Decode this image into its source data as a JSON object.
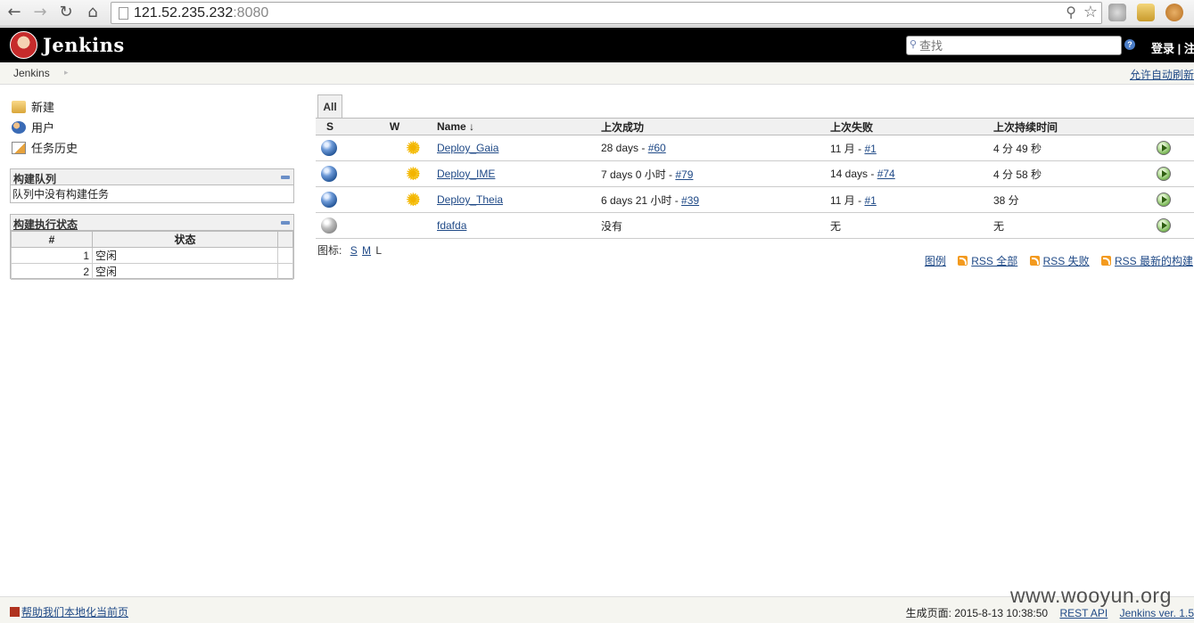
{
  "browser": {
    "url_host": "121.52.235.232",
    "url_port": ":8080"
  },
  "header": {
    "app_name": "Jenkins",
    "search_placeholder": "查找",
    "help_glyph": "?",
    "login_text": "登录 | 注"
  },
  "breadcrumb": {
    "root": "Jenkins",
    "auto_refresh": "允许自动刷新"
  },
  "sidebar": {
    "tasks": [
      {
        "label": "新建",
        "icon": "new-job-icon"
      },
      {
        "label": "用户",
        "icon": "users-icon"
      },
      {
        "label": "任务历史",
        "icon": "build-history-icon"
      }
    ],
    "queue": {
      "title": "构建队列",
      "empty_text": "队列中没有构建任务"
    },
    "executors": {
      "title": "构建执行状态",
      "col_number": "#",
      "col_status": "状态",
      "rows": [
        {
          "number": "1",
          "status": "空闲"
        },
        {
          "number": "2",
          "status": "空闲"
        }
      ]
    }
  },
  "main": {
    "tab_all": "All",
    "columns": {
      "s": "S",
      "w": "W",
      "name": "Name ↓",
      "last_success": "上次成功",
      "last_failure": "上次失败",
      "last_duration": "上次持续时间"
    },
    "jobs": [
      {
        "status": "blue",
        "weather": "sunny",
        "name": "Deploy_Gaia",
        "last_success_text": "28 days - ",
        "last_success_link": "#60",
        "last_failure_text": "11 月 - ",
        "last_failure_link": "#1",
        "duration": "4 分 49 秒"
      },
      {
        "status": "blue",
        "weather": "sunny",
        "name": "Deploy_IME",
        "last_success_text": "7 days 0 小时 - ",
        "last_success_link": "#79",
        "last_failure_text": "14 days - ",
        "last_failure_link": "#74",
        "duration": "4 分 58 秒"
      },
      {
        "status": "blue",
        "weather": "sunny",
        "name": "Deploy_Theia",
        "last_success_text": "6 days 21 小时 - ",
        "last_success_link": "#39",
        "last_failure_text": "11 月 - ",
        "last_failure_link": "#1",
        "duration": "38 分"
      },
      {
        "status": "grey",
        "weather": "",
        "name": "fdafda",
        "last_success_text": "没有",
        "last_success_link": "",
        "last_failure_text": "无",
        "last_failure_link": "",
        "duration": "无"
      }
    ],
    "icon_size": {
      "label": "图标:",
      "small": "S",
      "medium": "M",
      "large": "L"
    },
    "legend": "图例",
    "rss_all": "RSS 全部",
    "rss_failed": "RSS 失败",
    "rss_latest": "RSS 最新的构建"
  },
  "footer": {
    "localize": "帮助我们本地化当前页",
    "generated": "生成页面: 2015-8-13 10:38:50",
    "rest_api": "REST API",
    "version": "Jenkins ver. 1.5"
  },
  "watermark": "www.wooyun.org"
}
